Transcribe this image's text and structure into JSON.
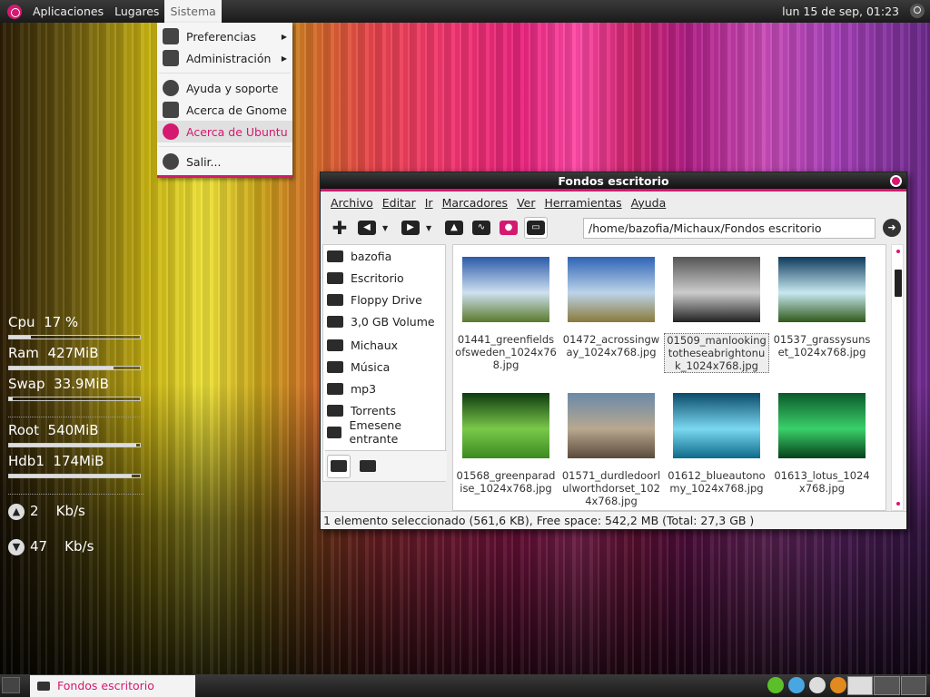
{
  "topbar": {
    "menus": [
      "Aplicaciones",
      "Lugares",
      "Sistema"
    ],
    "clock": "lun 15 de sep, 01:23"
  },
  "sistema_menu": {
    "items": [
      {
        "label": "Preferencias",
        "icon": "preferences-icon",
        "submenu": true
      },
      {
        "label": "Administración",
        "icon": "tools-icon",
        "submenu": true
      },
      {
        "label": "Ayuda y soporte",
        "icon": "help-icon",
        "submenu": false
      },
      {
        "label": "Acerca de Gnome",
        "icon": "gnome-foot-icon",
        "submenu": false
      },
      {
        "label": "Acerca de Ubuntu",
        "icon": "ubuntu-icon",
        "submenu": false,
        "highlighted": true
      },
      {
        "label": "Salir...",
        "icon": "power-icon",
        "submenu": false
      }
    ]
  },
  "conky": {
    "cpu_label": "Cpu",
    "cpu_value": "17 %",
    "cpu_fraction": 0.17,
    "ram_label": "Ram",
    "ram_value": "427MiB",
    "ram_fraction": 0.8,
    "swap_label": "Swap",
    "swap_value": "33.9MiB",
    "swap_fraction": 0.03,
    "root_label": "Root",
    "root_value": "540MiB",
    "root_fraction": 0.97,
    "hdb1_label": "Hdb1",
    "hdb1_value": "174MiB",
    "hdb1_fraction": 0.94,
    "up_value": "2",
    "up_unit": "Kb/s",
    "down_value": "47",
    "down_unit": "Kb/s"
  },
  "window": {
    "title": "Fondos escritorio",
    "menubar": [
      "Archivo",
      "Editar",
      "Ir",
      "Marcadores",
      "Ver",
      "Herramientas",
      "Ayuda"
    ],
    "location": "/home/bazofia/Michaux/Fondos escritorio",
    "sidebar": [
      "bazofia",
      "Escritorio",
      "Floppy Drive",
      "3,0 GB Volume",
      "Michaux",
      "Música",
      "mp3",
      "Torrents",
      "Emesene entrante"
    ],
    "files": [
      {
        "name": "01441_greenfieldsofsweden_1024x768.jpg",
        "colors": [
          "#2b5aa8",
          "#cfe0f0",
          "#5a7a2a"
        ]
      },
      {
        "name": "01472_acrossingway_1024x768.jpg",
        "colors": [
          "#2e63b5",
          "#bcd3e8",
          "#8a7a3a"
        ]
      },
      {
        "name": "01509_manlookingtotheseabrightonuk_1024x768.jpg",
        "colors": [
          "#555555",
          "#cccccc",
          "#222222"
        ],
        "selected": true
      },
      {
        "name": "01537_grassysunset_1024x768.jpg",
        "colors": [
          "#0d3a5c",
          "#c8e8f0",
          "#2f5a1a"
        ]
      },
      {
        "name": "01568_greenparadise_1024x768.jpg",
        "colors": [
          "#0e3a0e",
          "#7ac84a",
          "#3a8a20"
        ]
      },
      {
        "name": "01571_durdledoorlulworthdorset_1024x768.jpg",
        "colors": [
          "#6a8aa8",
          "#b8a890",
          "#5a4a3a"
        ]
      },
      {
        "name": "01612_blueautonomy_1024x768.jpg",
        "colors": [
          "#0a4a6a",
          "#7ad8f0",
          "#0d6a8a"
        ]
      },
      {
        "name": "01613_lotus_1024x768.jpg",
        "colors": [
          "#0a5a2a",
          "#3ad06a",
          "#06401a"
        ]
      }
    ],
    "status": "1 elemento seleccionado (561,6 KB), Free space: 542,2 MB (Total: 27,3 GB )"
  },
  "taskbar": {
    "task_label": "Fondos escritorio"
  }
}
